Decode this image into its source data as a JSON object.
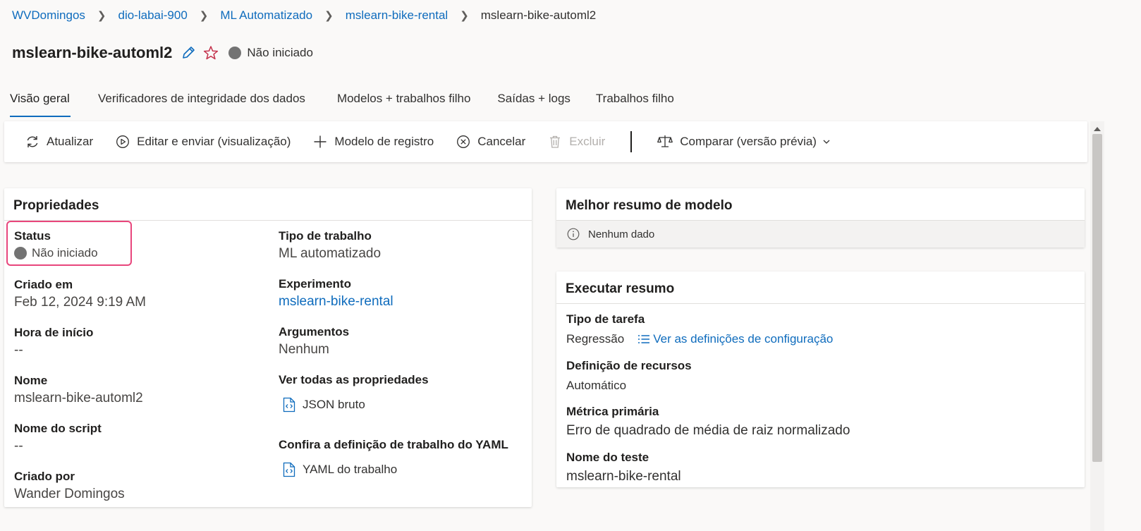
{
  "breadcrumb": [
    "WVDomingos",
    "dio-labai-900",
    "ML Automatizado",
    "mslearn-bike-rental",
    "mslearn-bike-automl2"
  ],
  "header": {
    "title": "mslearn-bike-automl2",
    "status": "Não iniciado"
  },
  "tabs": [
    "Visão geral",
    "Verificadores de integridade dos dados",
    "Modelos + trabalhos filho",
    "Saídas + logs",
    "Trabalhos filho"
  ],
  "toolbar": {
    "refresh": "Atualizar",
    "edit_submit": "Editar e enviar (visualização)",
    "register_model": "Modelo de registro",
    "cancel": "Cancelar",
    "delete": "Excluir",
    "compare": "Comparar (versão prévia)"
  },
  "properties": {
    "title": "Propriedades",
    "status_label": "Status",
    "status_value": "Não iniciado",
    "created_label": "Criado em",
    "created_value": "Feb 12, 2024 9:19 AM",
    "start_label": "Hora de início",
    "start_value": "--",
    "name_label": "Nome",
    "name_value": "mslearn-bike-automl2",
    "script_label": "Nome do script",
    "script_value": "--",
    "created_by_label": "Criado por",
    "created_by_value": "Wander Domingos",
    "job_type_label": "Tipo de trabalho",
    "job_type_value": "ML automatizado",
    "experiment_label": "Experimento",
    "experiment_value": "mslearn-bike-rental",
    "arguments_label": "Argumentos",
    "arguments_value": "Nenhum",
    "all_props_label": "Ver todas as propriedades",
    "raw_json": "JSON bruto",
    "yaml_label": "Confira a definição de trabalho do YAML",
    "yaml_link": "YAML do trabalho"
  },
  "best_model": {
    "title": "Melhor resumo de modelo",
    "empty": "Nenhum dado"
  },
  "run_summary": {
    "title": "Executar resumo",
    "task_type_label": "Tipo de tarefa",
    "task_type_value": "Regressão",
    "config_link": "Ver as definições de configuração",
    "resource_label": "Definição de recursos",
    "resource_value": "Automático",
    "metric_label": "Métrica primária",
    "metric_value": "Erro de quadrado de média de raiz normalizado",
    "experiment_name_label": "Nome do teste",
    "experiment_name_value": "mslearn-bike-rental"
  },
  "colors": {
    "accent": "#0f6cbd",
    "highlight": "#e8467c",
    "status_gray": "#737373"
  }
}
